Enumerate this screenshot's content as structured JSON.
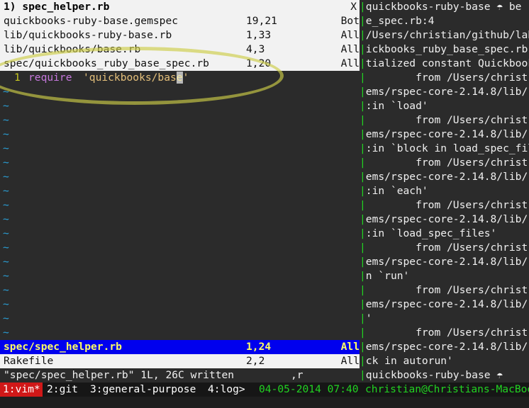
{
  "vim": {
    "title_bar": {
      "left": "1) spec_helper.rb",
      "right": "X"
    },
    "buffers_top": [
      {
        "name": "quickbooks-ruby-base.gemspec",
        "pos": "19,21",
        "pct": "Bot"
      },
      {
        "name": "lib/quickbooks-ruby-base.rb",
        "pos": "1,33",
        "pct": "All"
      },
      {
        "name": "lib/quickbooks/base.rb",
        "pos": "4,3",
        "pct": "All"
      },
      {
        "name": "spec/quickbooks_ruby_base_spec.rb",
        "pos": "1,20",
        "pct": "All"
      }
    ],
    "editor": {
      "line_number": "1",
      "keyword": "require",
      "string_before_cursor": "'quickbooks/bas",
      "cursor_char": "e",
      "string_after_cursor": "'",
      "tilde": "~"
    },
    "active_buffer": {
      "name": "spec/spec_helper.rb",
      "pos": "1,24",
      "pct": "All"
    },
    "buffers_bottom": [
      {
        "name": "Rakefile",
        "pos": "2,2",
        "pct": "All"
      }
    ],
    "command_line": {
      "message": "\"spec/spec_helper.rb\" 1L, 26C written",
      "pending": ",r"
    }
  },
  "terminal_lines": [
    "quickbooks-ruby-base ☂ be",
    "e_spec.rb:4",
    "/Users/christian/github/lab",
    "ickbooks_ruby_base_spec.rb",
    "tialized constant Quickbook",
    "        from /Users/christ",
    "ems/rspec-core-2.14.8/lib/r",
    ":in `load'",
    "        from /Users/christ",
    "ems/rspec-core-2.14.8/lib/r",
    ":in `block in load_spec_fil",
    "        from /Users/christ",
    "ems/rspec-core-2.14.8/lib/r",
    ":in `each'",
    "        from /Users/christ",
    "ems/rspec-core-2.14.8/lib/r",
    ":in `load_spec_files'",
    "        from /Users/christ",
    "ems/rspec-core-2.14.8/lib/r",
    "n `run'",
    "        from /Users/christ",
    "ems/rspec-core-2.14.8/lib/r",
    "'",
    "        from /Users/christ",
    "ems/rspec-core-2.14.8/lib/r",
    "ck in autorun'",
    "quickbooks-ruby-base ☂"
  ],
  "tmux": {
    "windows": [
      {
        "label": "1:vim*"
      },
      {
        "label": "2:git"
      },
      {
        "label": "3:general-purpose"
      },
      {
        "label": "4:log>"
      }
    ],
    "datetime": "04-05-2014 07:40",
    "host": "christian@Christians-MacBoo"
  },
  "colors": {
    "tilde": "#2a9fd6",
    "line_number": "#c8c820",
    "keyword": "#c678dd",
    "string": "#e5c07b",
    "active_buffer_bg": "#0000ee",
    "active_buffer_fg": "#ffff66",
    "pane_separator": "#22d322",
    "tmux_active_window_bg": "#d01818",
    "tmux_date": "#22d322",
    "tmux_host": "#22d322"
  }
}
